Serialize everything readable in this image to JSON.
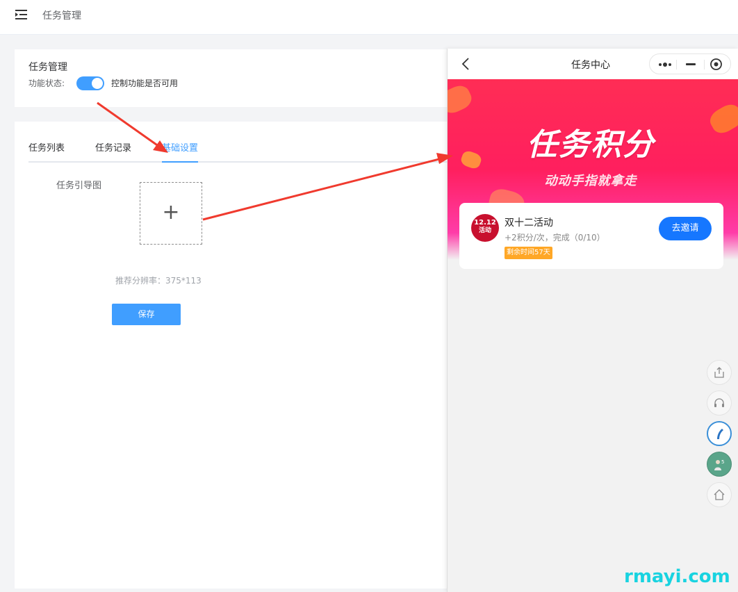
{
  "topbar": {
    "breadcrumb": "任务管理",
    "menu_icon": "menu-fold-icon"
  },
  "feature": {
    "title": "任务管理",
    "status_label": "功能状态:",
    "status_on": true,
    "status_desc": "控制功能是否可用"
  },
  "tabs": [
    {
      "label": "任务列表",
      "active": false
    },
    {
      "label": "任务记录",
      "active": false
    },
    {
      "label": "基础设置",
      "active": true
    }
  ],
  "form": {
    "guide_label": "任务引导图",
    "upload_icon": "+",
    "resolution_hint": "推荐分辨率：375*113",
    "save_label": "保存"
  },
  "phone": {
    "title": "任务中心",
    "banner_title": "任务积分",
    "banner_subtitle": "动动手指就拿走",
    "task": {
      "logo_line1": "12.12",
      "logo_line2": "活动",
      "name": "双十二活动",
      "desc": "+2积分/次，完成（0/10）",
      "badge": "剩余时间57天",
      "action": "去邀请"
    },
    "side_tools": [
      "share-icon",
      "headset-icon",
      "phone-call-icon",
      "avatar-icon",
      "home-icon"
    ],
    "avatar_badge": "5"
  },
  "watermark": "rmayi.com",
  "colors": {
    "primary": "#409eff",
    "banner": "#ff2d55",
    "invite": "#1677ff",
    "badge": "#ffa726",
    "arrow": "#f03a2e"
  }
}
